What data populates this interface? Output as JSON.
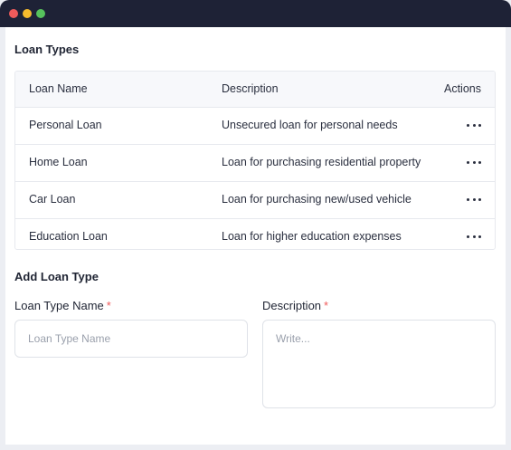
{
  "window": {
    "controls": [
      "close",
      "minimize",
      "maximize"
    ]
  },
  "loan_types": {
    "title": "Loan Types",
    "columns": {
      "name": "Loan Name",
      "description": "Description",
      "actions": "Actions"
    },
    "rows": [
      {
        "name": "Personal Loan",
        "description": "Unsecured loan for personal needs",
        "action_icon": "more-horizontal-icon"
      },
      {
        "name": "Home Loan",
        "description": "Loan for purchasing residential property",
        "action_icon": "more-horizontal-icon"
      },
      {
        "name": "Car Loan",
        "description": "Loan for purchasing new/used vehicle",
        "action_icon": "more-horizontal-icon"
      },
      {
        "name": "Education Loan",
        "description": "Loan for higher education expenses",
        "action_icon": "more-horizontal-icon"
      }
    ]
  },
  "add_form": {
    "title": "Add Loan Type",
    "name_label": "Loan Type Name",
    "name_required_mark": "*",
    "name_placeholder": "Loan Type Name",
    "name_value": "",
    "description_label": "Description",
    "description_required_mark": "*",
    "description_placeholder": "Write...",
    "description_value": ""
  },
  "colors": {
    "titlebar": "#1e2236",
    "required": "#ef5b5b",
    "close_dot": "#ef5b5b",
    "minimize_dot": "#f6bb2d",
    "maximize_dot": "#56c25c"
  }
}
